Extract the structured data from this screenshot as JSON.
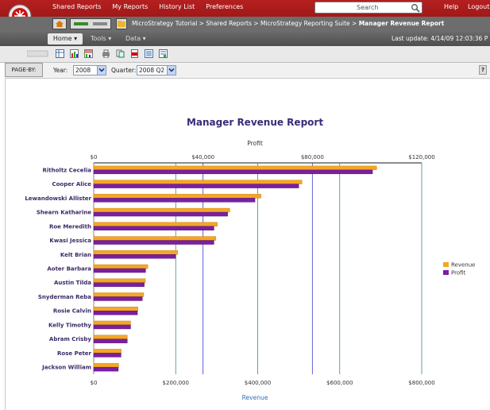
{
  "topbar": {
    "nav": [
      "Shared Reports",
      "My Reports",
      "History List",
      "Preferences"
    ],
    "search_label": "Search",
    "help": "Help",
    "logout": "Logout"
  },
  "breadcrumb": {
    "path": "MicroStrategy Tutorial > Shared Reports > MicroStrategy Reporting Suite > ",
    "current": "Manager Revenue Report"
  },
  "menubar": {
    "home": "Home ▾",
    "tools": "Tools ▾",
    "data": "Data ▾",
    "last_update": "Last update: 4/14/09 12:03:36 P"
  },
  "pageby": {
    "label": "PAGE-BY:",
    "year_label": "Year:",
    "year_value": "2008",
    "quarter_label": "Quarter:",
    "quarter_value": "2008 Q2",
    "help": "?"
  },
  "colors": {
    "revenue": "#f5a623",
    "profit": "#7a1fa2",
    "title": "#3b2b78"
  },
  "chart_data": {
    "type": "bar",
    "orientation": "horizontal",
    "title": "Manager Revenue Report",
    "top_axis_label": "Profit",
    "bottom_axis_label": "Revenue",
    "top_ticks": [
      "$0",
      "$40,000",
      "$80,000",
      "$120,000"
    ],
    "bottom_ticks": [
      "$0",
      "$200,000",
      "$400,000",
      "$600,000",
      "$800,000"
    ],
    "top_range": [
      0,
      120000
    ],
    "bottom_range": [
      0,
      800000
    ],
    "categories": [
      "Ritholtz Cecelia",
      "Cooper Alice",
      "Lewandowski Allister",
      "Shearn Katharine",
      "Roe Meredith",
      "Kwasi Jessica",
      "Kelt Brian",
      "Aoter Barbara",
      "Austin Tilda",
      "Snyderman Reba",
      "Rosie Calvin",
      "Kelly Timothy",
      "Abram Crisby",
      "Rose Peter",
      "Jackson William"
    ],
    "series": [
      {
        "name": "Revenue",
        "values": [
          690000,
          508000,
          408000,
          332000,
          302000,
          298000,
          205000,
          132000,
          126000,
          122000,
          108000,
          90000,
          82000,
          67000,
          61000
        ]
      },
      {
        "name": "Profit",
        "values": [
          102000,
          75000,
          59000,
          49000,
          44000,
          44000,
          30000,
          19000,
          18500,
          17800,
          16000,
          13500,
          12300,
          10000,
          9000
        ]
      }
    ],
    "legend": "right",
    "grid": true
  }
}
